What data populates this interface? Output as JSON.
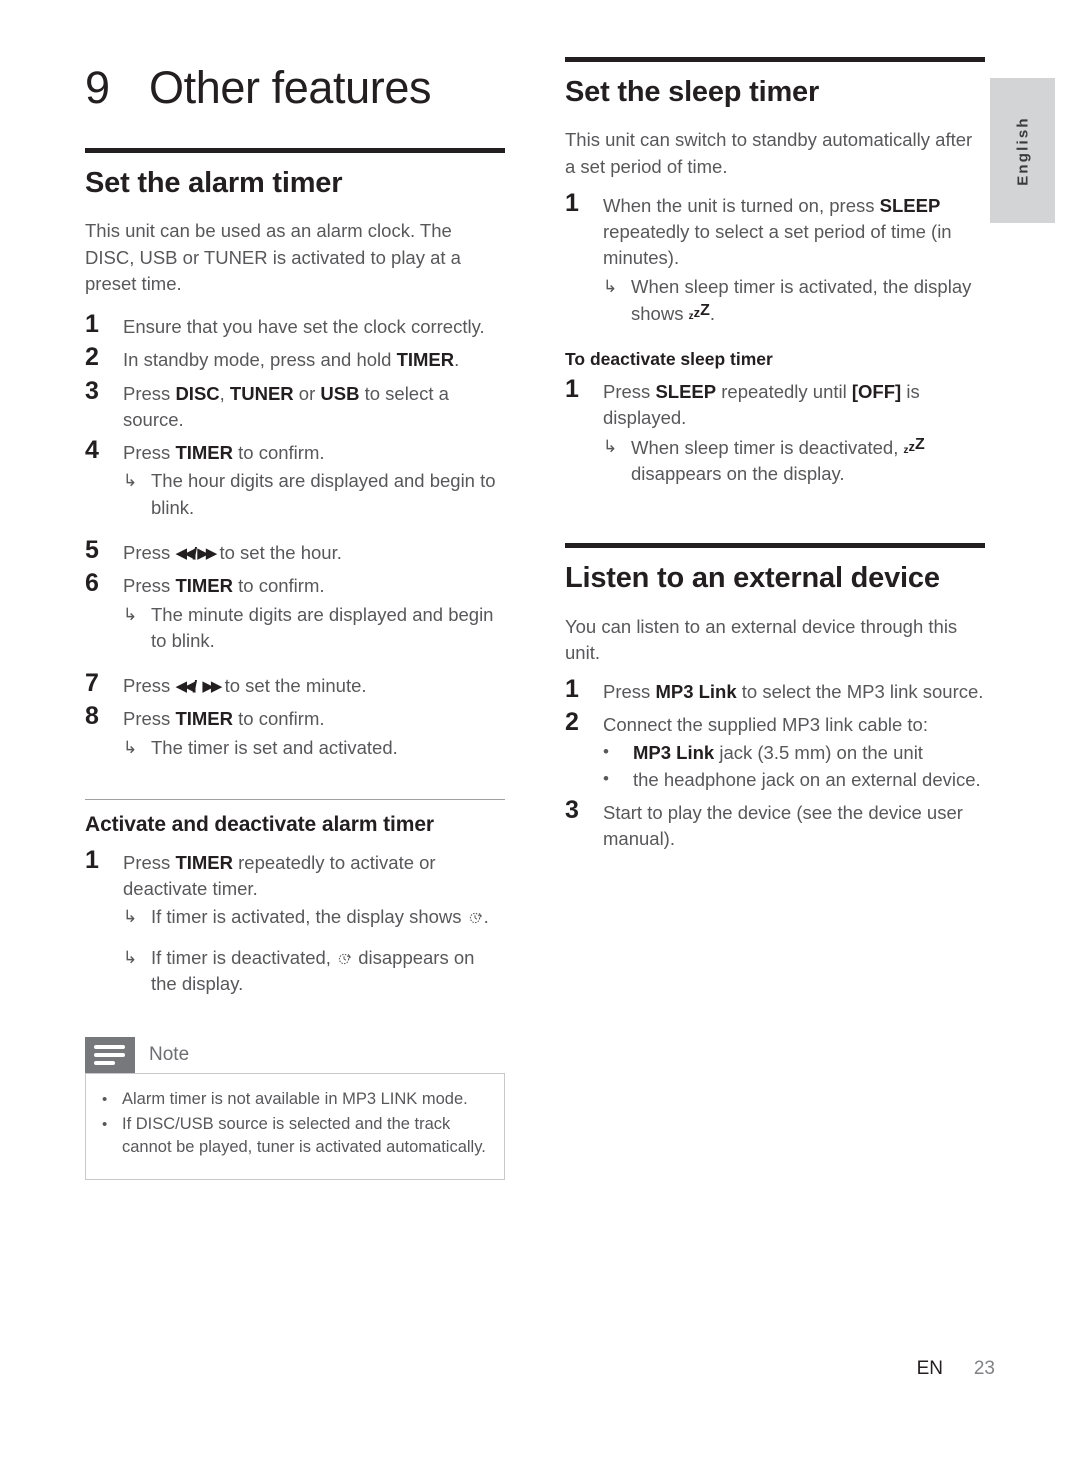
{
  "page": {
    "language_tab": "English",
    "footer_lang": "EN",
    "footer_page": "23"
  },
  "chapter": {
    "number": "9",
    "title": "Other features"
  },
  "left_column": {
    "alarm": {
      "heading": "Set the alarm timer",
      "intro": "This unit can be used as an alarm clock. The DISC, USB or TUNER is activated to play at a preset time.",
      "steps": [
        {
          "num": "1",
          "text_before": "Ensure that you have set the clock correctly."
        },
        {
          "num": "2",
          "text_before": "In standby mode, press and hold ",
          "bold": "TIMER",
          "text_after": "."
        },
        {
          "num": "3",
          "text_before": "Press ",
          "bold": "DISC",
          "text_mid1": ", ",
          "bold2": "TUNER",
          "text_mid2": " or ",
          "bold3": "USB",
          "text_after": " to select a source."
        },
        {
          "num": "4",
          "text_before": "Press ",
          "bold": "TIMER",
          "text_after": " to confirm.",
          "result": "The hour digits are displayed and begin to blink."
        },
        {
          "num": "5",
          "text_before": "Press ",
          "glyph": "prev-next",
          "text_after": " to set the hour."
        },
        {
          "num": "6",
          "text_before": "Press ",
          "bold": "TIMER",
          "text_after": " to confirm.",
          "result": "The minute digits are displayed and begin to blink."
        },
        {
          "num": "7",
          "text_before": "Press ",
          "glyph": "prev-next-spaced",
          "text_after": " to set the minute."
        },
        {
          "num": "8",
          "text_before": "Press ",
          "bold": "TIMER",
          "text_after": " to confirm.",
          "result": "The timer is set and activated."
        }
      ]
    },
    "activate": {
      "heading": "Activate and deactivate alarm timer",
      "step_num": "1",
      "step_before": "Press ",
      "step_bold": "TIMER",
      "step_after": " repeatedly to activate or deactivate timer.",
      "result_activated_before": "If timer is activated, the display shows ",
      "result_activated_after": ".",
      "result_deactivated_before": "If timer is deactivated, ",
      "result_deactivated_after": " disappears on the display."
    },
    "note": {
      "label": "Note",
      "items": [
        "Alarm timer is not available in MP3 LINK mode.",
        "If DISC/USB source is selected and the track cannot be played, tuner is activated automatically."
      ]
    }
  },
  "right_column": {
    "sleep": {
      "heading": "Set the sleep timer",
      "intro": "This unit can switch to standby automatically after a set period of time.",
      "step_num": "1",
      "step_before": "When the unit is turned on, press ",
      "step_bold": "SLEEP",
      "step_after": " repeatedly to select a set period of time (in minutes).",
      "result_before": "When sleep timer is activated, the display shows ",
      "result_after": ".",
      "deactivate_heading": "To deactivate sleep timer",
      "deactivate_step_num": "1",
      "deactivate_before": "Press ",
      "deactivate_bold": "SLEEP",
      "deactivate_mid": " repeatedly until ",
      "deactivate_bold2": "[OFF]",
      "deactivate_after": " is displayed.",
      "deactivate_result_before": "When sleep timer is deactivated, ",
      "deactivate_result_after": " disappears on the display."
    },
    "external": {
      "heading": "Listen to an external device",
      "intro": "You can listen to an external device through this unit.",
      "step1_num": "1",
      "step1_before": "Press ",
      "step1_bold": "MP3 Link",
      "step1_after": " to select the MP3 link source.",
      "step2_num": "2",
      "step2_text": "Connect the supplied MP3 link cable to:",
      "bullet1_bold": "MP3 Link",
      "bullet1_after": " jack (3.5 mm) on the unit",
      "bullet2": "the headphone jack on an external device.",
      "step3_num": "3",
      "step3_text": "Start to play the device (see the device user manual)."
    }
  },
  "glyphs": {
    "result_arrow": "↳",
    "bullet": "•",
    "prev": "◀◀",
    "next": "▶▶",
    "separator": "/"
  },
  "colors": {
    "ink": "#231f20",
    "body_text": "#58585b",
    "rule": "#231f20",
    "thin_rule": "#9d9fa2",
    "note_tab": "#77787b",
    "note_border": "#c7c8ca",
    "lang_tab": "#d2d4d5"
  }
}
